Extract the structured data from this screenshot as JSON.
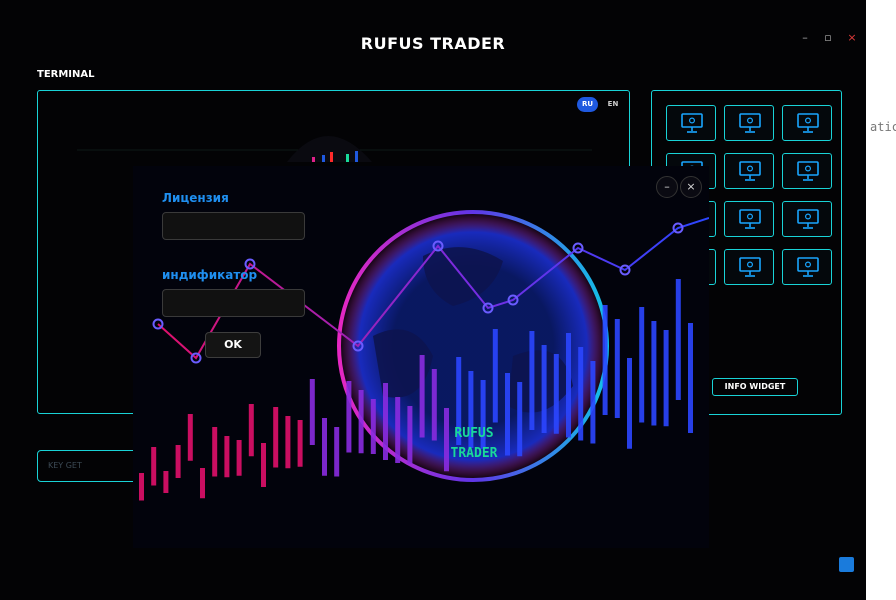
{
  "app": {
    "title": "RUFUS TRADER"
  },
  "window_controls": {
    "minimize": "–",
    "maximize": "▫",
    "close": "×"
  },
  "terminal": {
    "label": "TERMINAL",
    "lang_ru": "RU",
    "lang_en": "EN"
  },
  "widgets": {
    "button_label": "INFO WIDGET",
    "count": 12,
    "icon": "monitor-icon",
    "accent": "#19d3d7"
  },
  "keyget": {
    "placeholder": "KEY GET"
  },
  "popup": {
    "license_label": "Лицензия",
    "license_value": "",
    "id_label": "индификатор",
    "id_value": "",
    "ok_label": "OK",
    "minimize": "–",
    "close": "×",
    "brand_line1": "RUFUS",
    "brand_line2": "TRADER",
    "accent": "#1f8ff0"
  },
  "colors": {
    "cyan": "#19d3d7",
    "blue": "#1f59e0",
    "magenta": "#e0208a",
    "brand_green": "#19d99a"
  },
  "strip_text": "atic"
}
